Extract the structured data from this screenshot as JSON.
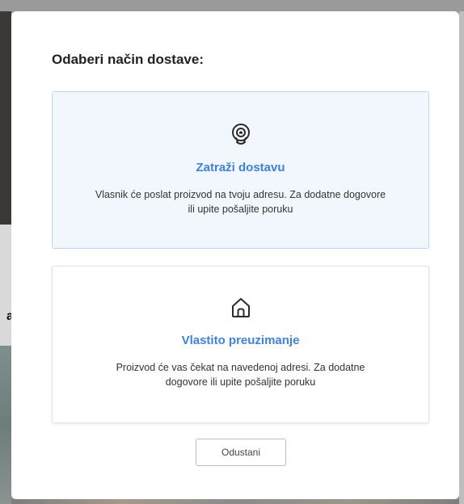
{
  "modal": {
    "title": "Odaberi način dostave:",
    "options": [
      {
        "icon": "location-pin-icon",
        "heading": "Zatraži dostavu",
        "description": "Vlasnik će poslat proizvod na tvoju adresu. Za dodatne dogovore ili upite pošaljite poruku",
        "selected": true
      },
      {
        "icon": "house-icon",
        "heading": "Vlastito preuzimanje",
        "description": "Proizvod će vas čekat na navedenoj adresi. Za dodatne dogovore ili upite pošaljite poruku",
        "selected": false
      }
    ],
    "cancel_label": "Odustani"
  },
  "background": {
    "partial_text": "a"
  },
  "colors": {
    "accent": "#3b82e8",
    "selected_bg": "#f2f7fe",
    "selected_border": "#bcd6f7"
  }
}
